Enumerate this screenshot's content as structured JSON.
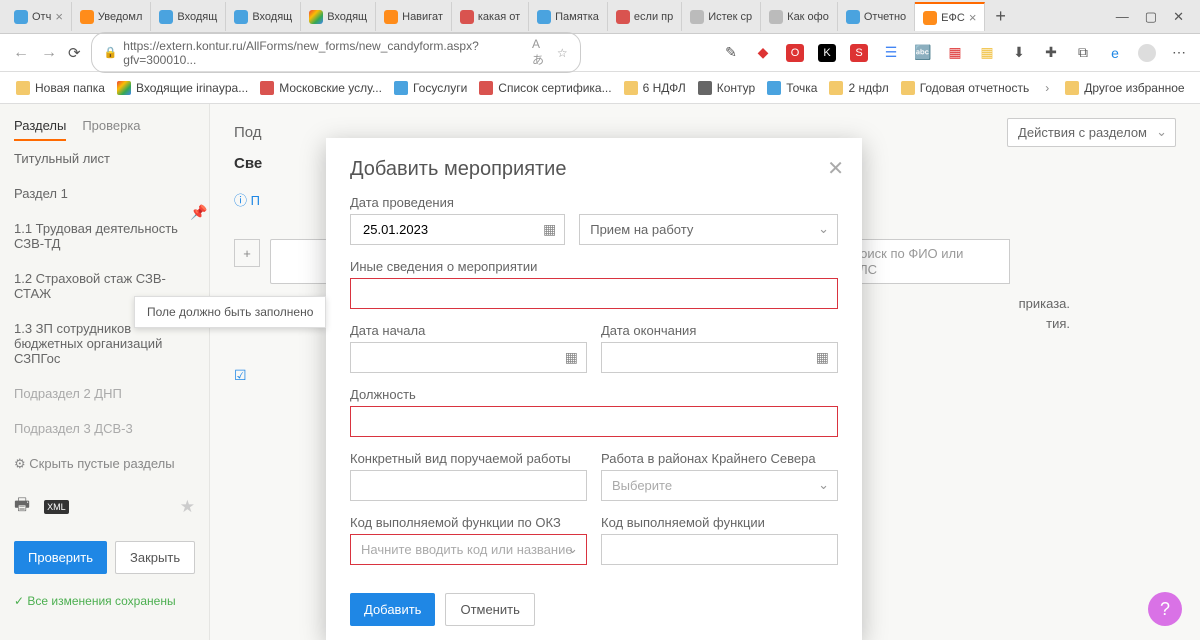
{
  "browser": {
    "tabs": [
      {
        "label": "Отч",
        "fav": "c-blue",
        "close": true
      },
      {
        "label": "Уведомл",
        "fav": "c-orange"
      },
      {
        "label": "Входящ",
        "fav": "c-blue"
      },
      {
        "label": "Входящ",
        "fav": "c-blue"
      },
      {
        "label": "Входящ",
        "fav": "c-gm"
      },
      {
        "label": "Навигат",
        "fav": "c-orange"
      },
      {
        "label": "какая от",
        "fav": "c-red"
      },
      {
        "label": "Памятка",
        "fav": "c-blue"
      },
      {
        "label": "если пр",
        "fav": "c-red"
      },
      {
        "label": "Истек ср",
        "fav": "c-grey"
      },
      {
        "label": "Как офо",
        "fav": "c-grey"
      },
      {
        "label": "Отчетно",
        "fav": "c-blue"
      },
      {
        "label": "ЕФС",
        "fav": "c-orange",
        "active": true,
        "close": true
      }
    ],
    "url": "https://extern.kontur.ru/AllForms/new_forms/new_candyform.aspx?gfv=300010...",
    "bookmarks": [
      {
        "label": "Новая папка",
        "fav": "c-folder"
      },
      {
        "label": "Входящие irinayра...",
        "fav": "c-gm"
      },
      {
        "label": "Московские услу...",
        "fav": "c-red"
      },
      {
        "label": "Госуслуги",
        "fav": "c-blue"
      },
      {
        "label": "Список сертифика...",
        "fav": "c-red"
      },
      {
        "label": "6 НДФЛ",
        "fav": "c-folder"
      },
      {
        "label": "Контур",
        "fav": "c-kontur"
      },
      {
        "label": "Точка",
        "fav": "c-blue"
      },
      {
        "label": "2 ндфл",
        "fav": "c-folder"
      },
      {
        "label": "Годовая отчетность",
        "fav": "c-folder"
      }
    ],
    "bookmarks_more": "Другое избранное"
  },
  "sidebar": {
    "tabs": {
      "sections": "Разделы",
      "check": "Проверка"
    },
    "items": [
      {
        "label": "Титульный лист"
      },
      {
        "label": "Раздел 1"
      },
      {
        "label": "1.1 Трудовая деятельность СЗВ-ТД"
      },
      {
        "label": "1.2 Страховой стаж СЗВ-СТАЖ"
      },
      {
        "label": "1.3 ЗП сотрудников бюджетных организаций СЗПГос"
      },
      {
        "label": "Подраздел 2 ДНП",
        "dim": true
      },
      {
        "label": "Подраздел 3 ДСВ-3",
        "dim": true
      }
    ],
    "hide": "Скрыть пустые разделы",
    "check_btn": "Проверить",
    "close_btn": "Закрыть",
    "saved": "Все изменения сохранены"
  },
  "main": {
    "title": "Под",
    "subtitle": "Све",
    "hint_link": "П",
    "actions_select": "Действия с разделом",
    "search_placeholder": "Поиск по ФИО или СНИЛС",
    "bg_info1": "приказа.",
    "bg_info2": "тия."
  },
  "modal": {
    "title": "Добавить мероприятие",
    "labels": {
      "date": "Дата проведения",
      "other": "Иные сведения о мероприятии",
      "start": "Дата начала",
      "end": "Дата окончания",
      "position": "Должность",
      "work_kind": "Конкретный вид поручаемой работы",
      "north": "Работа в районах Крайнего Севера",
      "okz": "Код выполняемой функции по ОКЗ",
      "func": "Код выполняемой функции"
    },
    "values": {
      "date": "25.01.2023",
      "type_select": "Прием на работу",
      "north_placeholder": "Выберите",
      "okz_placeholder": "Начните вводить код или название"
    },
    "tooltip": "Поле должно быть заполнено",
    "add_btn": "Добавить",
    "cancel_btn": "Отменить"
  },
  "help": "?"
}
